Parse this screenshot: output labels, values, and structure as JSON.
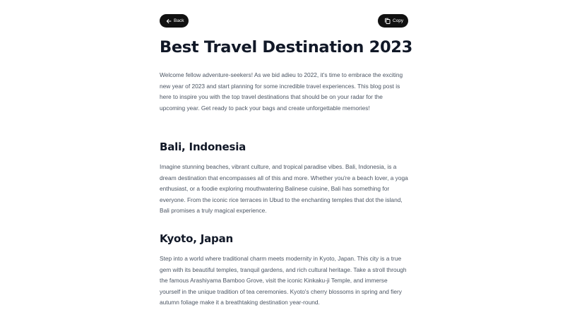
{
  "toolbar": {
    "back_label": "Back",
    "copy_label": "Copy",
    "back_icon": "arrow-left-icon",
    "copy_icon": "copy-icon"
  },
  "article": {
    "title": "Best Travel Destination 2023",
    "intro": "Welcome fellow adventure-seekers! As we bid adieu to 2022, it's time to embrace the exciting new year of 2023 and start planning for some incredible travel experiences. This blog post is here to inspire you with the top travel destinations that should be on your radar for the upcoming year. Get ready to pack your bags and create unforgettable memories!",
    "sections": [
      {
        "heading": "Bali, Indonesia",
        "body": "Imagine stunning beaches, vibrant culture, and tropical paradise vibes. Bali, Indonesia, is a dream destination that encompasses all of this and more. Whether you're a beach lover, a yoga enthusiast, or a foodie exploring mouthwatering Balinese cuisine, Bali has something for everyone. From the iconic rice terraces in Ubud to the enchanting temples that dot the island, Bali promises a truly magical experience."
      },
      {
        "heading": "Kyoto, Japan",
        "body": "Step into a world where traditional charm meets modernity in Kyoto, Japan. This city is a true gem with its beautiful temples, tranquil gardens, and rich cultural heritage. Take a stroll through the famous Arashiyama Bamboo Grove, visit the iconic Kinkaku-ji Temple, and immerse yourself in the unique tradition of tea ceremonies. Kyoto's cherry blossoms in spring and fiery autumn foliage make it a breathtaking destination year-round."
      }
    ]
  }
}
